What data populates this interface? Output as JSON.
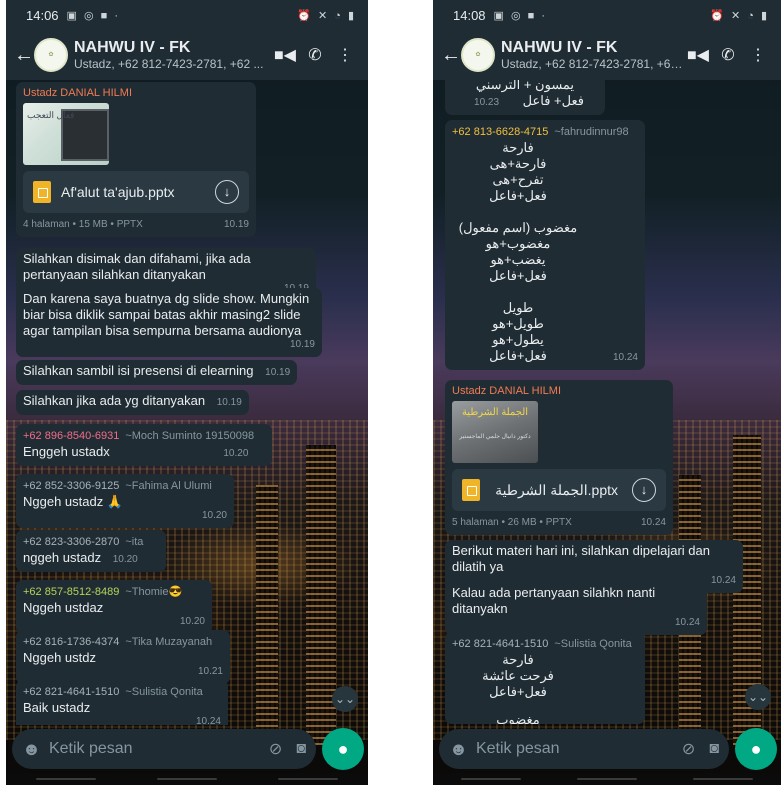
{
  "left": {
    "status_time": "14:06",
    "title": "NAHWU IV - FK",
    "subtitle": "Ustadz, +62 812-7423-2781, +62 ...",
    "messages": {
      "m1": {
        "sender": "Ustadz DANIAL HILMI",
        "sender_color": "#f07b54",
        "preview_text": "فعال التعجب",
        "doc_name": "Af'alut ta'ajub.pptx",
        "doc_meta": "4 halaman • 15 MB • PPTX",
        "time": "10.19"
      },
      "m2": {
        "text": "Silahkan disimak dan difahami, jika ada pertanyaan silahkan ditanyakan",
        "time": "10.19"
      },
      "m3": {
        "text": "Dan karena saya buatnya dg slide show. Mungkin biar bisa diklik sampai batas akhir masing2 slide agar tampilan bisa sempurna bersama audionya",
        "time": "10.19"
      },
      "m4": {
        "text": "Silahkan sambil isi presensi di elearning",
        "time": "10.19"
      },
      "m5": {
        "text": "Silahkan jika ada yg ditanyakan",
        "time": "10.19"
      },
      "m6": {
        "phone": "+62 896-8540-6931",
        "alias": "~Moch Suminto 19150098",
        "phone_color": "#f46b8a",
        "text": "Enggeh ustadx",
        "time": "10.20"
      },
      "m7": {
        "phone": "+62 852-3306-9125",
        "alias": "~Fahima Al Ulumi",
        "phone_color": "#a7b3b9",
        "text": "Nggeh ustadz 🙏",
        "time": "10.20"
      },
      "m8": {
        "phone": "+62 823-3306-2870",
        "alias": "~ita",
        "phone_color": "#a7b3b9",
        "text": "nggeh ustadz",
        "time": "10.20"
      },
      "m9": {
        "phone": "+62 857-8512-8489",
        "alias": "~Thomie😎",
        "phone_color": "#b4d45a",
        "text": "Nggeh ustdaz",
        "time": "10.20"
      },
      "m10": {
        "phone": "+62 816-1736-4374",
        "alias": "~Tika Muzayanah",
        "phone_color": "#a7b3b9",
        "text": "Nggeh ustdz",
        "time": "10.21"
      },
      "m11": {
        "phone": "+62 821-4641-1510",
        "alias": "~Sulistia Qonita",
        "phone_color": "#a7b3b9",
        "text": "Baik ustadz",
        "time": "10.24"
      }
    },
    "input_placeholder": "Ketik pesan"
  },
  "right": {
    "status_time": "14:08",
    "title": "NAHWU IV - FK",
    "subtitle": "Ustadz, +62 812-7423-2781, +62 ...",
    "messages": {
      "r0": {
        "line1": "يمسون + الترسني",
        "line2": "فعل+ فاعل",
        "time": "10.23"
      },
      "r1": {
        "phone": "+62 813-6628-4715",
        "alias": "~fahrudinnur98",
        "phone_color": "#f0c040",
        "lines": [
          "فارحة",
          "فارحة+هى",
          "تفرح+هى",
          "فعل+فاعل",
          "",
          "مغضوب (اسم مفعول)",
          "مغضوب+هو",
          "يغضب+هو",
          "فعل+فاعل",
          "",
          "طويل",
          "طويل+هو",
          "يطول+هو",
          "فعل+فاعل"
        ],
        "time": "10.24"
      },
      "r2": {
        "sender": "Ustadz DANIAL HILMI",
        "sender_color": "#f07b54",
        "preview_title": "الجملة الشرطية",
        "preview_sub": "دكتور دانيال حلمي الماجستير",
        "doc_name": "الجملة الشرطية.pptx",
        "doc_meta": "5 halaman • 26 MB • PPTX",
        "time": "10.24"
      },
      "r3": {
        "text": "Berikut materi hari ini, silahkan dipelajari dan dilatih ya",
        "time": "10.24"
      },
      "r4": {
        "text": "Kalau ada pertanyaan silahkn nanti ditanyakn",
        "time": "10.24"
      },
      "r5": {
        "phone": "+62 821-4641-1510",
        "alias": "~Sulistia Qonita",
        "phone_color": "#a7b3b9",
        "lines": [
          "فارحة",
          "فرحت عائشة",
          "فعل+فاعل",
          "",
          "مغضوب"
        ]
      }
    },
    "input_placeholder": "Ketik pesan"
  }
}
